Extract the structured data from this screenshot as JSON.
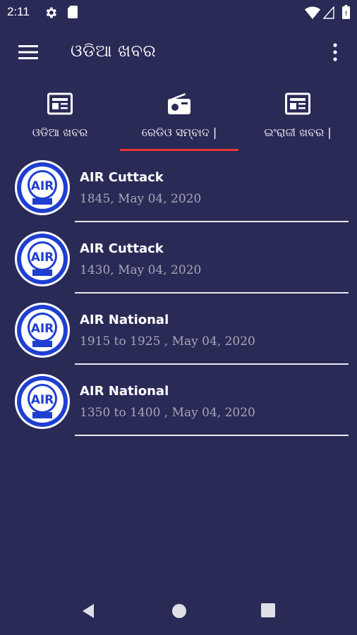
{
  "status_bar": {
    "time": "2:11",
    "icons": [
      "gear-icon",
      "sd-card-icon",
      "wifi-icon",
      "signal-icon",
      "battery-icon"
    ]
  },
  "app_bar": {
    "title": "ଓଡିଆ ଖବର",
    "menu_icon": "menu-icon",
    "overflow_icon": "more-vert-icon"
  },
  "tabs": [
    {
      "label": "ଓଡିଆ ଖବର",
      "icon": "newspaper-icon",
      "selected": false
    },
    {
      "label": "ରେଡିଓ ସମ୍ବାଦ |",
      "icon": "radio-icon",
      "selected": true
    },
    {
      "label": "ଇଂରାଜୀ ଖବର |",
      "icon": "newspaper-icon",
      "selected": false
    }
  ],
  "items": [
    {
      "title": "AIR Cuttack",
      "subtitle": "1845, May 04, 2020",
      "logo_text": "AIR"
    },
    {
      "title": "AIR Cuttack",
      "subtitle": "1430, May 04, 2020",
      "logo_text": "AIR"
    },
    {
      "title": "AIR National",
      "subtitle": "1915 to 1925 , May 04, 2020",
      "logo_text": "AIR"
    },
    {
      "title": "AIR National",
      "subtitle": "1350 to 1400 , May 04, 2020",
      "logo_text": "AIR"
    }
  ],
  "colors": {
    "background": "#2a2a57",
    "tab_indicator": "#e53935",
    "logo_blue": "#1f3fd0",
    "subtitle": "#a6a6b8"
  }
}
